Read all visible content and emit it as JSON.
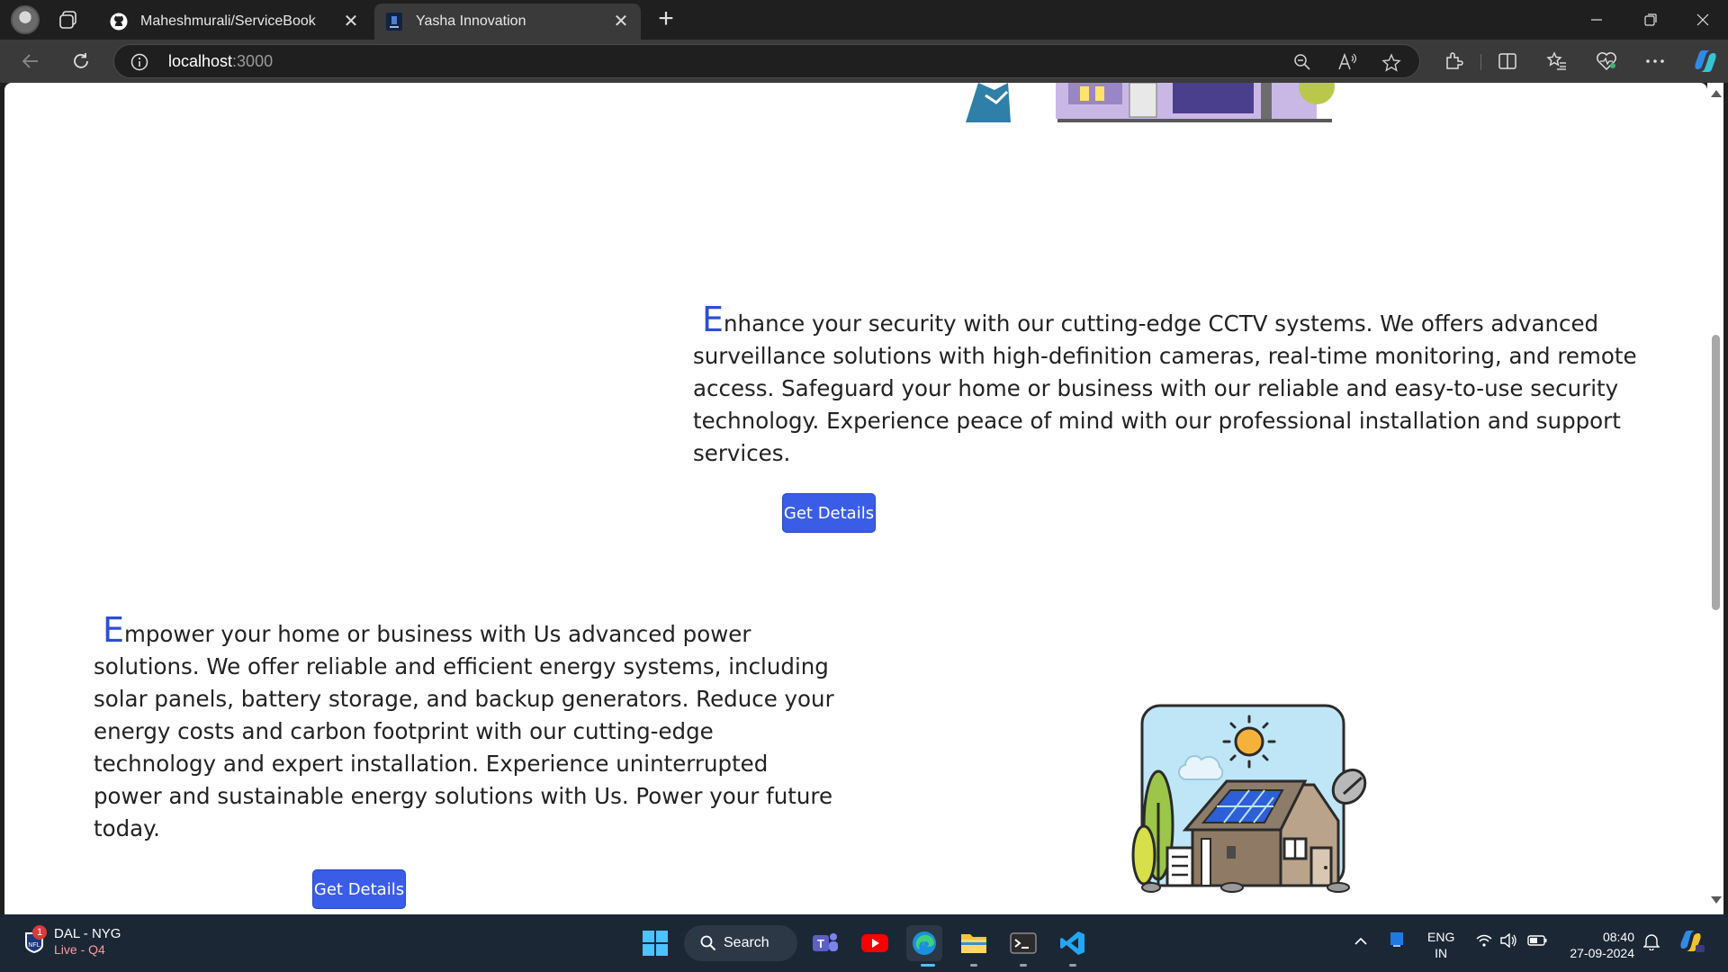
{
  "browser": {
    "tabs": [
      {
        "title": "Maheshmurali/ServiceBook",
        "active": false,
        "icon": "github-icon"
      },
      {
        "title": "Yasha Innovation",
        "active": true,
        "icon": "site-favicon"
      }
    ],
    "address": {
      "host": "localhost",
      "port": ":3000"
    },
    "close_glyph": "✕",
    "new_tab_glyph": "+"
  },
  "page": {
    "cctv": {
      "drop_letter": "E",
      "text": "nhance your security with our cutting-edge CCTV systems. We offers advanced surveillance solutions with high-definition cameras, real-time monitoring, and remote access. Safeguard your home or business with our reliable and easy-to-use security technology. Experience peace of mind with our professional installation and support services.",
      "button": "Get Details"
    },
    "power": {
      "drop_letter": "E",
      "text": "mpower your home or business with Us advanced power solutions. We offer reliable and efficient energy systems, including solar panels, battery storage, and backup generators. Reduce your energy costs and carbon footprint with our cutting-edge technology and expert installation. Experience uninterrupted power and sustainable energy solutions with Us. Power your future today.",
      "button": "Get Details"
    },
    "accent_color": "#3a5de8"
  },
  "taskbar": {
    "widget": {
      "badge": "1",
      "score": "DAL - NYG",
      "status": "Live - Q4"
    },
    "search_label": "Search",
    "lang": {
      "line1": "ENG",
      "line2": "IN"
    },
    "clock": {
      "time": "08:40",
      "date": "27-09-2024"
    }
  }
}
